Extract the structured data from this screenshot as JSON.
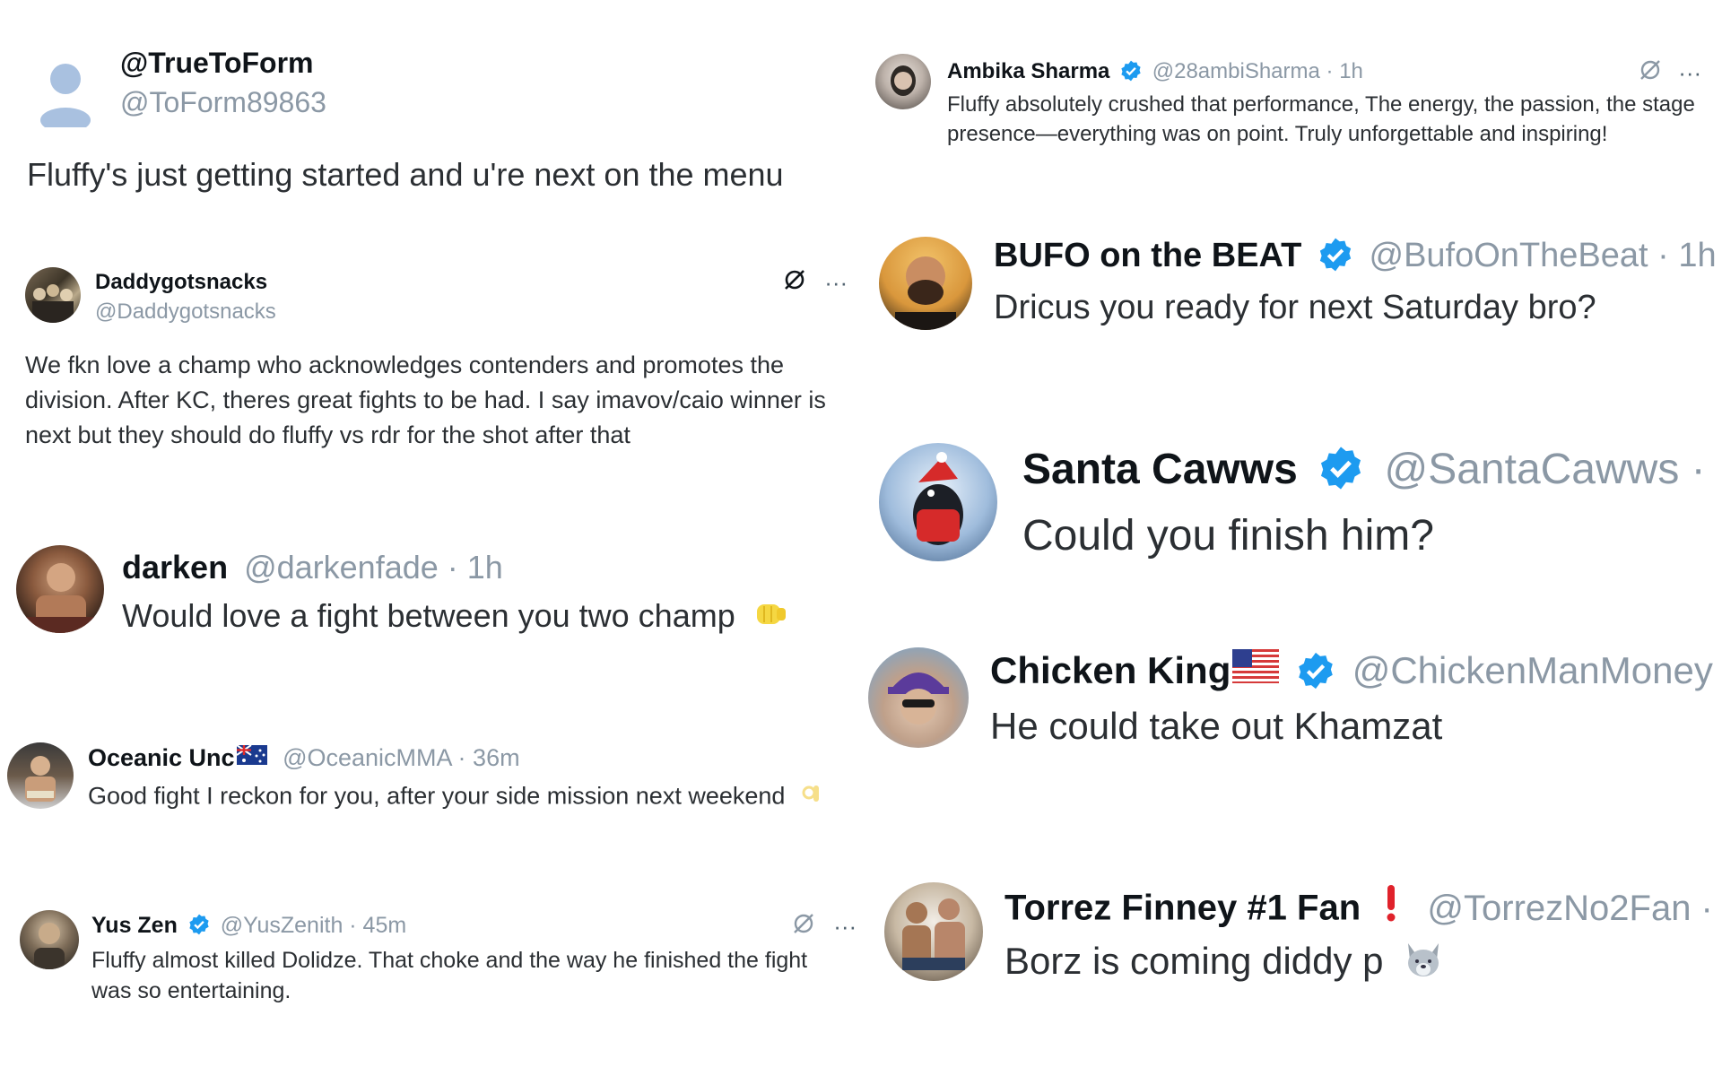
{
  "colors": {
    "verified": "#1d9bf0",
    "handle": "#8b98a5",
    "name": "#0f1419",
    "body": "#2b2f33"
  },
  "left": [
    {
      "name": "@TrueToForm",
      "handle": "@ToForm89863",
      "text": "Fluffy's just getting started and u're next on the menu",
      "avatar": "default-person-avatar"
    },
    {
      "name": "Daddygotsnacks",
      "handle": "@Daddygotsnacks",
      "text": "We fkn love a champ who acknowledges contenders and promotes the division. After KC, theres great fights to be had. I say imavov/caio winner is next but they should do fluffy vs rdr for the shot after that",
      "avatar": "group-photo-avatar",
      "more": "···"
    },
    {
      "name": "darken",
      "handle": "@darkenfade · 1h",
      "text": "Would love a fight between you two champ",
      "emoji": "fist-bump-emoji",
      "avatar": "fighter-photo-avatar"
    },
    {
      "name": "Oceanic Unc",
      "handle": "@OceanicMMA · 36m",
      "text": "Good fight I reckon for you, after your side mission next weekend",
      "emoji": "ok-hand-emoji",
      "flag": "australia-flag",
      "avatar": "ring-photo-avatar"
    },
    {
      "name": "Yus Zen",
      "handle": "@YusZenith · 45m",
      "text": "Fluffy almost killed Dolidze. That choke and the way he finished the fight was so entertaining.",
      "verified": true,
      "avatar": "portrait-avatar",
      "more": "···"
    }
  ],
  "right": [
    {
      "name": "Ambika Sharma",
      "handle": "@28ambiSharma · 1h",
      "text": "Fluffy absolutely crushed that performance, The energy, the passion, the stage presence—everything was on point. Truly unforgettable and inspiring!",
      "verified": true,
      "avatar": "woman-portrait-avatar",
      "more": "···"
    },
    {
      "name": "BUFO on the BEAT",
      "handle": "@BufoOnTheBeat · 1h",
      "text": "Dricus you ready for next Saturday bro?",
      "verified": true,
      "avatar": "bearded-man-avatar"
    },
    {
      "name": "Santa Cawws",
      "handle": "@SantaCawws ·",
      "text": "Could you finish him?",
      "verified": true,
      "avatar": "crow-santa-avatar"
    },
    {
      "name": "Chicken King",
      "handle": "@ChickenManMoney",
      "text": "He could take out Khamzat",
      "verified": true,
      "flag": "usa-flag",
      "avatar": "man-cap-avatar"
    },
    {
      "name": "Torrez Finney #1 Fan",
      "handle": "@TorrezNo2Fan ·",
      "text": "Borz is coming diddy p",
      "emoji": "wolf-emoji",
      "badge": "red-exclamation-icon",
      "avatar": "two-men-avatar"
    }
  ]
}
